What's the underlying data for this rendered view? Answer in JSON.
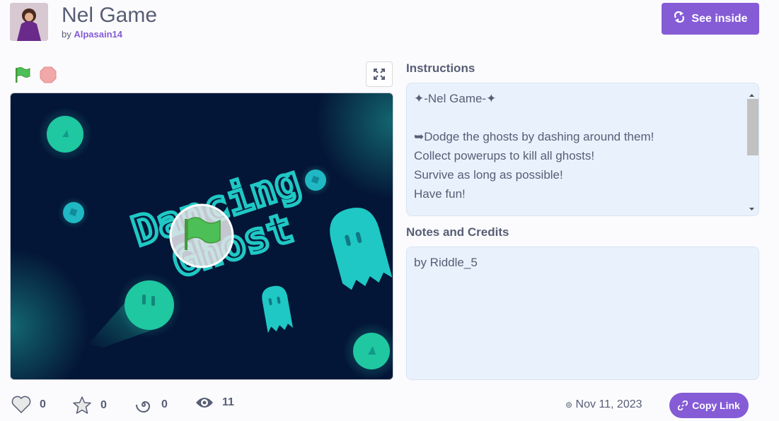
{
  "project": {
    "title": "Nel Game",
    "by_prefix": "by",
    "author": "Alpasain14"
  },
  "header": {
    "see_inside_label": "See inside"
  },
  "stage": {
    "logo_text_line1": "Dancing",
    "logo_text_line2": "Ghost"
  },
  "instructions": {
    "heading": "Instructions",
    "lines": [
      "✦-Nel Game-✦",
      "",
      "➥Dodge the ghosts by dashing around them!",
      "Collect powerups to kill all ghosts!",
      "Survive as long as possible!",
      "Have fun!"
    ]
  },
  "notes": {
    "heading": "Notes and Credits",
    "text": "by Riddle_5"
  },
  "stats": {
    "loves": "0",
    "favorites": "0",
    "remixes": "0",
    "views": "11"
  },
  "footer": {
    "date": "Nov 11, 2023",
    "copy_link_label": "Copy Link"
  },
  "colors": {
    "accent": "#855cd6",
    "text": "#575e75",
    "stage_bg": "#041637",
    "ghost": "#1fc8c4"
  }
}
